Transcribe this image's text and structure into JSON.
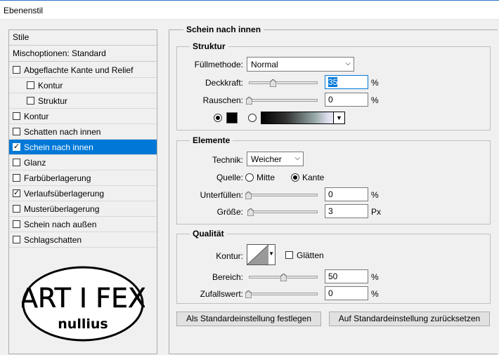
{
  "window": {
    "title": "Ebenenstil"
  },
  "styles_panel": {
    "header": "Stile",
    "blend_options": "Mischoptionen: Standard",
    "items": [
      {
        "label": "Abgeflachte Kante und Relief",
        "checked": false,
        "indent": false,
        "selected": false
      },
      {
        "label": "Kontur",
        "checked": false,
        "indent": true,
        "selected": false
      },
      {
        "label": "Struktur",
        "checked": false,
        "indent": true,
        "selected": false
      },
      {
        "label": "Kontur",
        "checked": false,
        "indent": false,
        "selected": false
      },
      {
        "label": "Schatten nach innen",
        "checked": false,
        "indent": false,
        "selected": false
      },
      {
        "label": "Schein nach innen",
        "checked": true,
        "indent": false,
        "selected": true
      },
      {
        "label": "Glanz",
        "checked": false,
        "indent": false,
        "selected": false
      },
      {
        "label": "Farbüberlagerung",
        "checked": false,
        "indent": false,
        "selected": false
      },
      {
        "label": "Verlaufsüberlagerung",
        "checked": true,
        "indent": false,
        "selected": false
      },
      {
        "label": "Musterüberlagerung",
        "checked": false,
        "indent": false,
        "selected": false
      },
      {
        "label": "Schein nach außen",
        "checked": false,
        "indent": false,
        "selected": false
      },
      {
        "label": "Schlagschatten",
        "checked": false,
        "indent": false,
        "selected": false
      }
    ],
    "logo": {
      "line1": "ART I FEX",
      "line2": "nullius"
    }
  },
  "main": {
    "title": "Schein nach innen",
    "structure": {
      "title": "Struktur",
      "blend_mode_label": "Füllmethode:",
      "blend_mode_value": "Normal",
      "opacity_label": "Deckkraft:",
      "opacity_value": "35",
      "opacity_unit": "%",
      "opacity_level": 0.35,
      "noise_label": "Rauschen:",
      "noise_value": "0",
      "noise_unit": "%",
      "noise_level": 0,
      "color_swatch": "#000000"
    },
    "elements": {
      "title": "Elemente",
      "technique_label": "Technik:",
      "technique_value": "Weicher",
      "source_label": "Quelle:",
      "source_center": "Mitte",
      "source_edge": "Kante",
      "choke_label": "Unterfüllen:",
      "choke_value": "0",
      "choke_unit": "%",
      "size_label": "Größe:",
      "size_value": "3",
      "size_unit": "Px"
    },
    "quality": {
      "title": "Qualität",
      "contour_label": "Kontur:",
      "antialias_label": "Glätten",
      "range_label": "Bereich:",
      "range_value": "50",
      "range_unit": "%",
      "range_level": 0.5,
      "jitter_label": "Zufallswert:",
      "jitter_value": "0",
      "jitter_unit": "%"
    },
    "buttons": {
      "make_default": "Als Standardeinstellung festlegen",
      "reset_default": "Auf Standardeinstellung zurücksetzen"
    }
  }
}
